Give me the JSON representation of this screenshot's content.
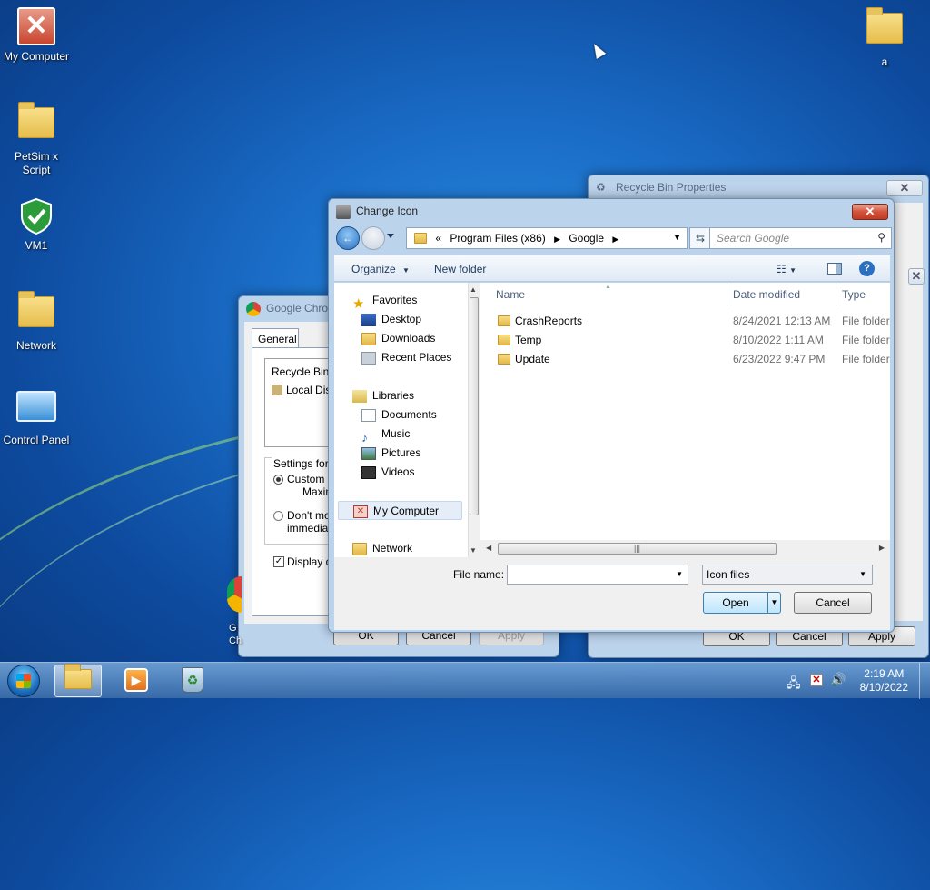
{
  "desktop": {
    "icons": [
      {
        "label": "My Computer",
        "icon": "my-computer-icon"
      },
      {
        "label": "PetSim x Script",
        "icon": "script-file-icon"
      },
      {
        "label": "VM1",
        "icon": "shield-check-icon"
      },
      {
        "label": "Network",
        "icon": "network-folder-icon"
      },
      {
        "label": "Control Panel",
        "icon": "control-panel-icon"
      },
      {
        "label": "a",
        "icon": "folder-icon"
      }
    ],
    "partial_icon_label": "G\nCh"
  },
  "recycle_props": {
    "title": "Recycle Bin Properties",
    "buttons": {
      "ok": "OK",
      "cancel": "Cancel",
      "apply": "Apply"
    }
  },
  "chrome_props": {
    "title": "Google Chro",
    "tab": "General",
    "list_header": "Recycle Bin L",
    "list_item": "Local Disk",
    "settings_label": "Settings for s",
    "opt_custom": "Custom s",
    "opt_custom_sub": "Maxim",
    "opt_dont": "Don't mov",
    "opt_dont_sub": "immediat",
    "display_check": "Display d",
    "buttons": {
      "ok": "OK",
      "cancel": "Cancel",
      "apply": "Apply"
    }
  },
  "dialog": {
    "title": "Change Icon",
    "address": {
      "prefix": "«",
      "crumbs": [
        "Program Files (x86)",
        "Google"
      ]
    },
    "search_placeholder": "Search Google",
    "toolbar": {
      "organize": "Organize",
      "new_folder": "New folder"
    },
    "nav": {
      "favorites": "Favorites",
      "desktop": "Desktop",
      "downloads": "Downloads",
      "recent": "Recent Places",
      "libraries": "Libraries",
      "documents": "Documents",
      "music": "Music",
      "pictures": "Pictures",
      "videos": "Videos",
      "mycomputer": "My Computer",
      "network": "Network"
    },
    "columns": {
      "name": "Name",
      "date": "Date modified",
      "type": "Type"
    },
    "files": [
      {
        "name": "CrashReports",
        "date": "8/24/2021 12:13 AM",
        "type": "File folder"
      },
      {
        "name": "Temp",
        "date": "8/10/2022 1:11 AM",
        "type": "File folder"
      },
      {
        "name": "Update",
        "date": "6/23/2022 9:47 PM",
        "type": "File folder"
      }
    ],
    "filename_label": "File name:",
    "filename_value": "",
    "filetype": "Icon files",
    "open": "Open",
    "cancel": "Cancel"
  },
  "taskbar": {
    "time": "2:19 AM",
    "date": "8/10/2022"
  }
}
